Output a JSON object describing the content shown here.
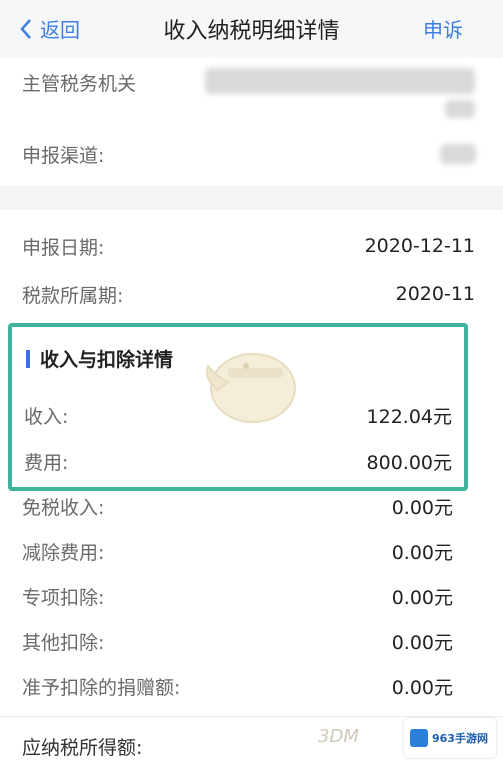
{
  "nav": {
    "back_label": "返回",
    "title": "收入纳税明细详情",
    "appeal_label": "申诉"
  },
  "top_section": {
    "tax_authority_label": "主管税务机关",
    "channel_label": "申报渠道:"
  },
  "date_section": {
    "declare_date_label": "申报日期:",
    "declare_date_value": "2020-12-11",
    "tax_period_label": "税款所属期:",
    "tax_period_value": "2020-11"
  },
  "detail_section": {
    "title": "收入与扣除详情",
    "items": [
      {
        "label": "收入:",
        "value": "122.04元"
      },
      {
        "label": "费用:",
        "value": "800.00元"
      },
      {
        "label": "免税收入:",
        "value": "0.00元"
      },
      {
        "label": "减除费用:",
        "value": "0.00元"
      },
      {
        "label": "专项扣除:",
        "value": "0.00元"
      },
      {
        "label": "其他扣除:",
        "value": "0.00元"
      },
      {
        "label": "准予扣除的捐赠额:",
        "value": "0.00元"
      }
    ]
  },
  "taxable_section": {
    "label": "应纳税所得额:"
  },
  "watermarks": {
    "site_logo": "963手游网",
    "brand_3d": "3DM"
  },
  "colors": {
    "accent_blue": "#3f7fe0",
    "highlight_border": "#3fb39c",
    "section_bar": "#3f6fe0"
  }
}
